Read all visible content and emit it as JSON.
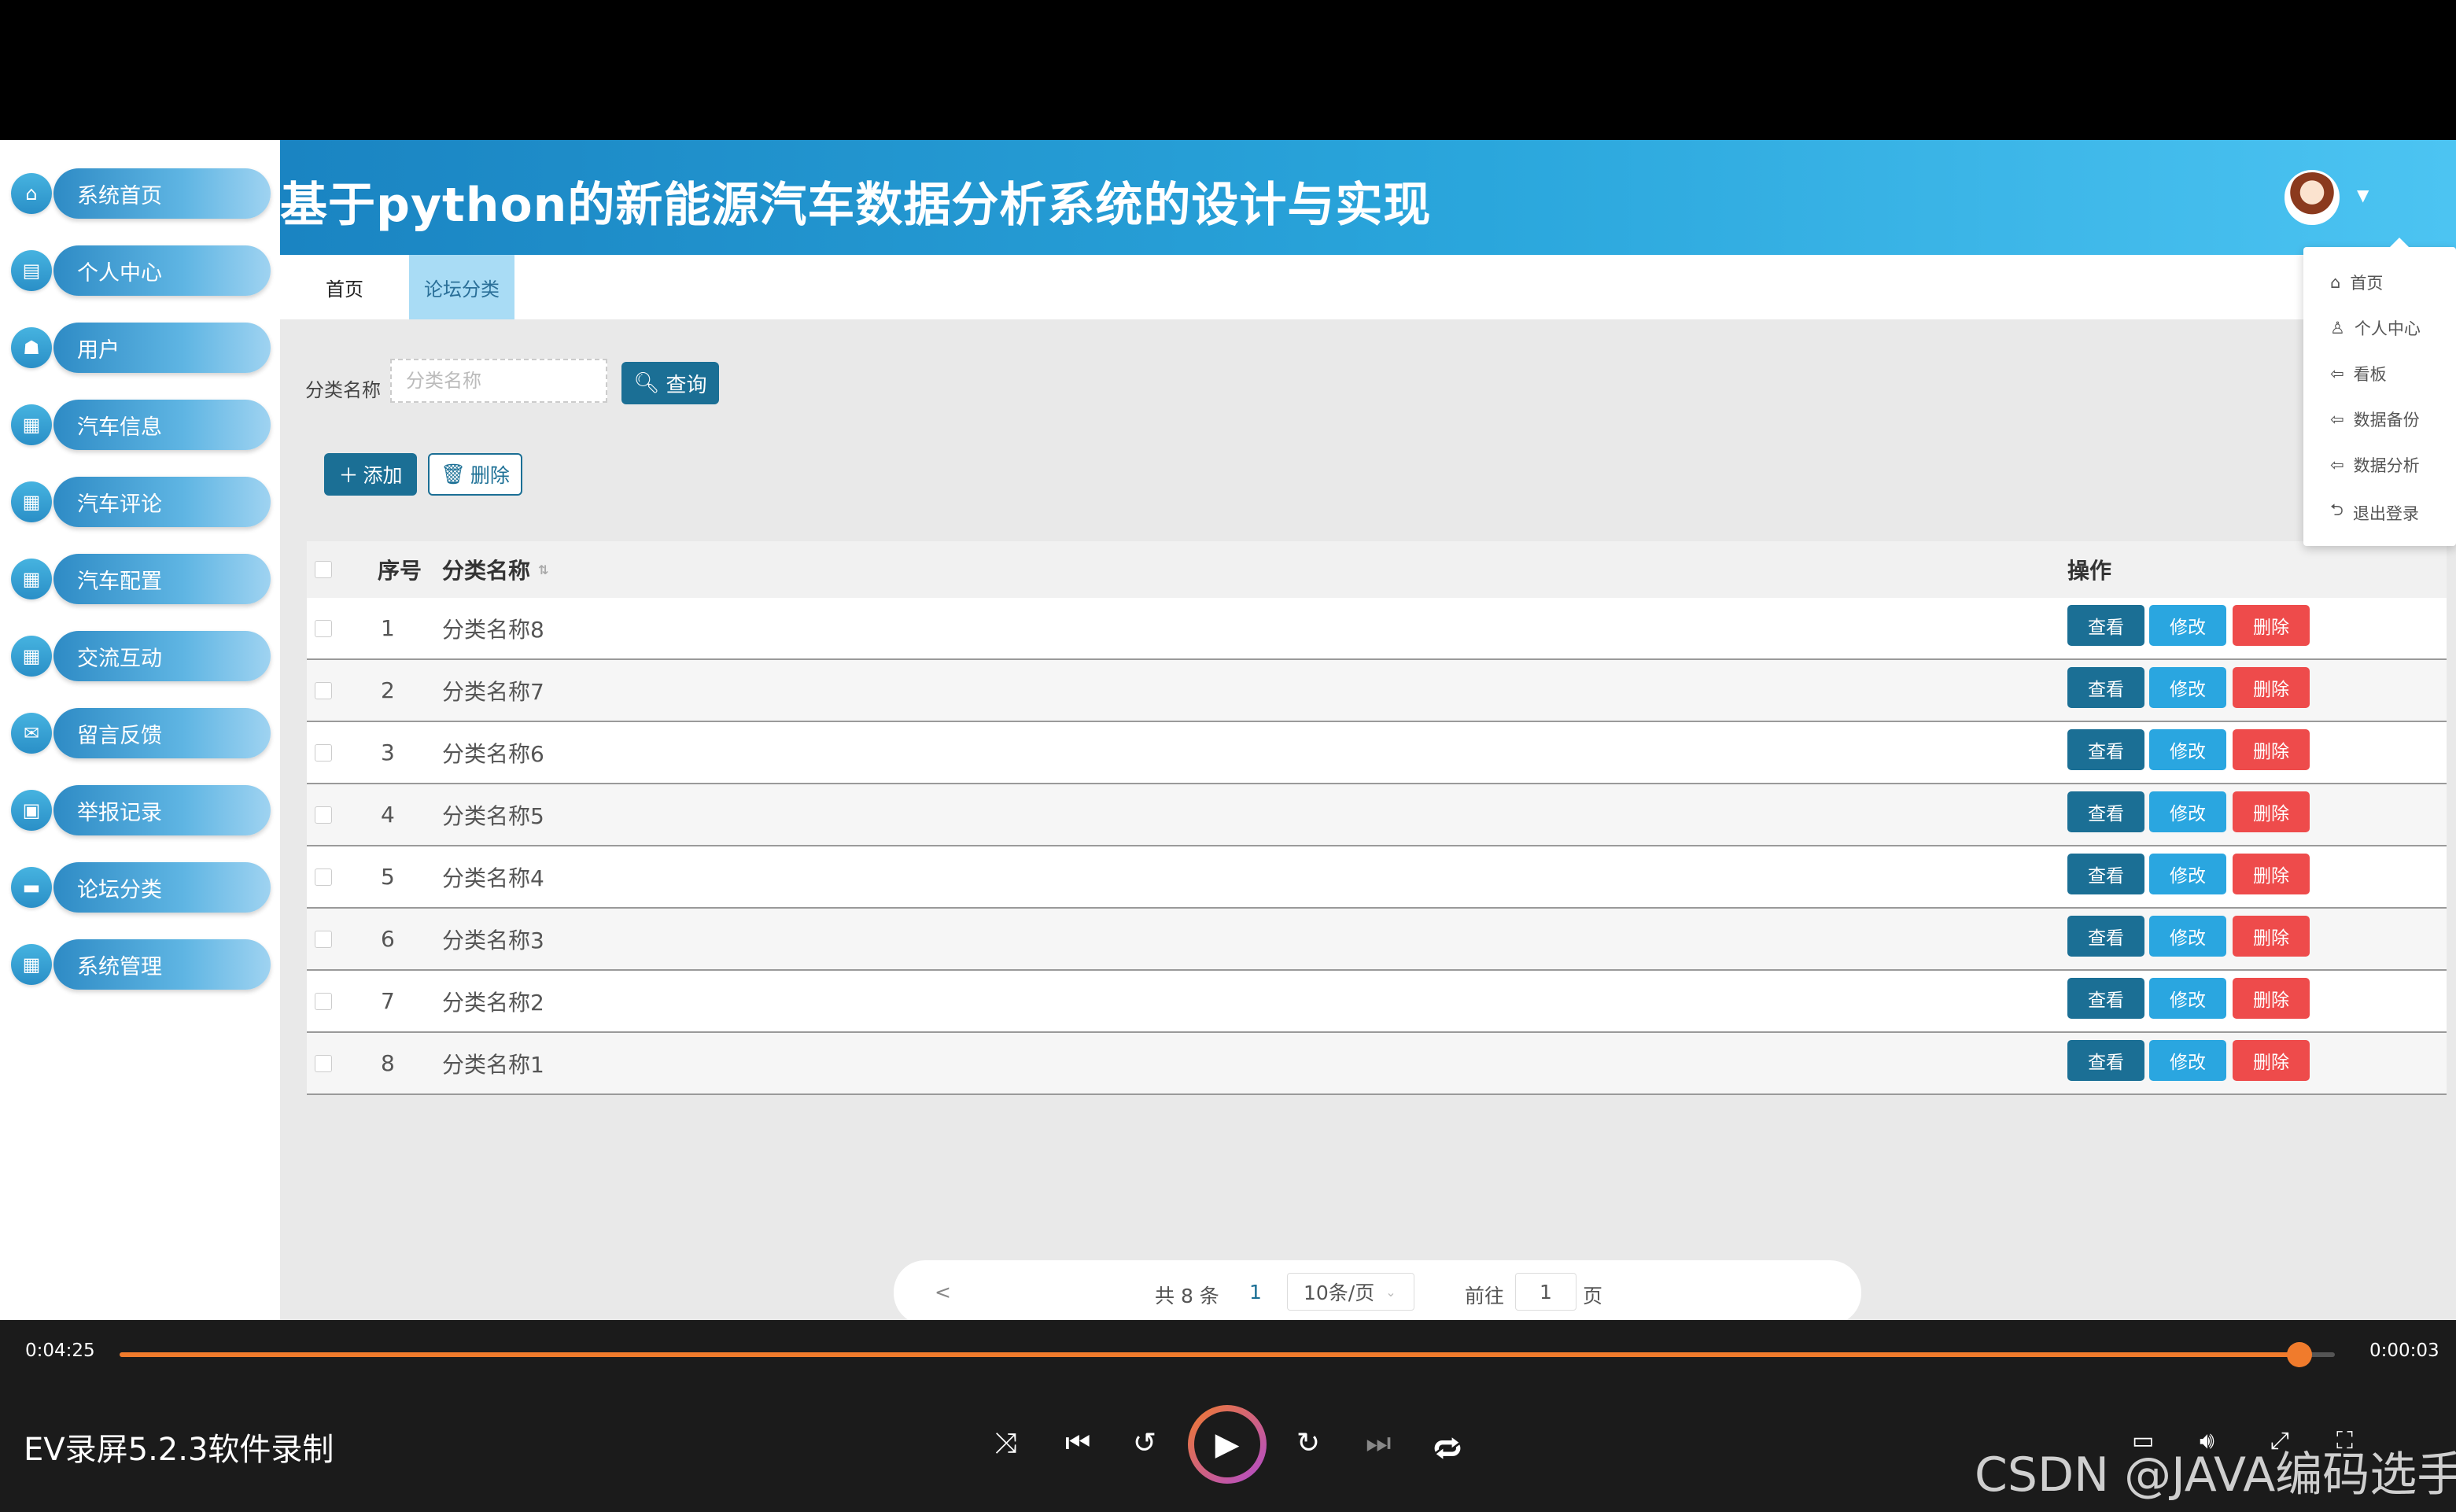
{
  "app_title": "基于python的新能源汽车数据分析系统的设计与实现",
  "sidebar": {
    "items": [
      {
        "label": "系统首页",
        "icon": "home-icon",
        "glyph": "⌂"
      },
      {
        "label": "个人中心",
        "icon": "profile-icon",
        "glyph": "▤"
      },
      {
        "label": "用户",
        "icon": "user-icon",
        "glyph": "☗"
      },
      {
        "label": "汽车信息",
        "icon": "grid-icon",
        "glyph": "▦"
      },
      {
        "label": "汽车评论",
        "icon": "grid-icon",
        "glyph": "▦"
      },
      {
        "label": "汽车配置",
        "icon": "grid-icon",
        "glyph": "▦"
      },
      {
        "label": "交流互动",
        "icon": "grid-icon",
        "glyph": "▦"
      },
      {
        "label": "留言反馈",
        "icon": "feedback-icon",
        "glyph": "✉"
      },
      {
        "label": "举报记录",
        "icon": "report-icon",
        "glyph": "▣"
      },
      {
        "label": "论坛分类",
        "icon": "forum-icon",
        "glyph": "▬"
      },
      {
        "label": "系统管理",
        "icon": "grid-icon",
        "glyph": "▦"
      }
    ]
  },
  "tabs": [
    {
      "label": "首页",
      "active": false
    },
    {
      "label": "论坛分类",
      "active": true
    }
  ],
  "search": {
    "label": "分类名称",
    "placeholder": "分类名称",
    "button": "查询"
  },
  "actions": {
    "add": "添加",
    "delete": "删除"
  },
  "table": {
    "headers": {
      "index": "序号",
      "name": "分类名称",
      "ops": "操作"
    },
    "rows": [
      {
        "index": "1",
        "name": "分类名称8"
      },
      {
        "index": "2",
        "name": "分类名称7"
      },
      {
        "index": "3",
        "name": "分类名称6"
      },
      {
        "index": "4",
        "name": "分类名称5"
      },
      {
        "index": "5",
        "name": "分类名称4"
      },
      {
        "index": "6",
        "name": "分类名称3"
      },
      {
        "index": "7",
        "name": "分类名称2"
      },
      {
        "index": "8",
        "name": "分类名称1"
      }
    ],
    "row_buttons": {
      "view": "查看",
      "edit": "修改",
      "delete": "删除"
    }
  },
  "pagination": {
    "prev": "<",
    "total": "共 8 条",
    "current_page": "1",
    "page_size": "10条/页",
    "goto_label": "前往",
    "goto_value": "1",
    "page_suffix": "页"
  },
  "user_menu": {
    "items": [
      {
        "label": "首页",
        "icon": "home-icon",
        "glyph": "⌂"
      },
      {
        "label": "个人中心",
        "icon": "user-icon",
        "glyph": "♙"
      },
      {
        "label": "看板",
        "icon": "arrow-left-icon",
        "glyph": "⇦"
      },
      {
        "label": "数据备份",
        "icon": "arrow-left-icon",
        "glyph": "⇦"
      },
      {
        "label": "数据分析",
        "icon": "arrow-left-icon",
        "glyph": "⇦"
      },
      {
        "label": "退出登录",
        "icon": "logout-icon",
        "glyph": "⮌"
      }
    ]
  },
  "player": {
    "elapsed": "0:04:25",
    "remaining": "0:00:03",
    "progress": 0.984,
    "title": "EV录屏5.2.3软件录制",
    "accent": "#f07b2c"
  },
  "watermark": "CSDN @JAVA编码选手",
  "colors": {
    "header_start": "#1a84c2",
    "header_end": "#4cc4f2",
    "primary": "#1b6f95",
    "edit": "#2aa6e0",
    "danger": "#ee4b4b"
  }
}
